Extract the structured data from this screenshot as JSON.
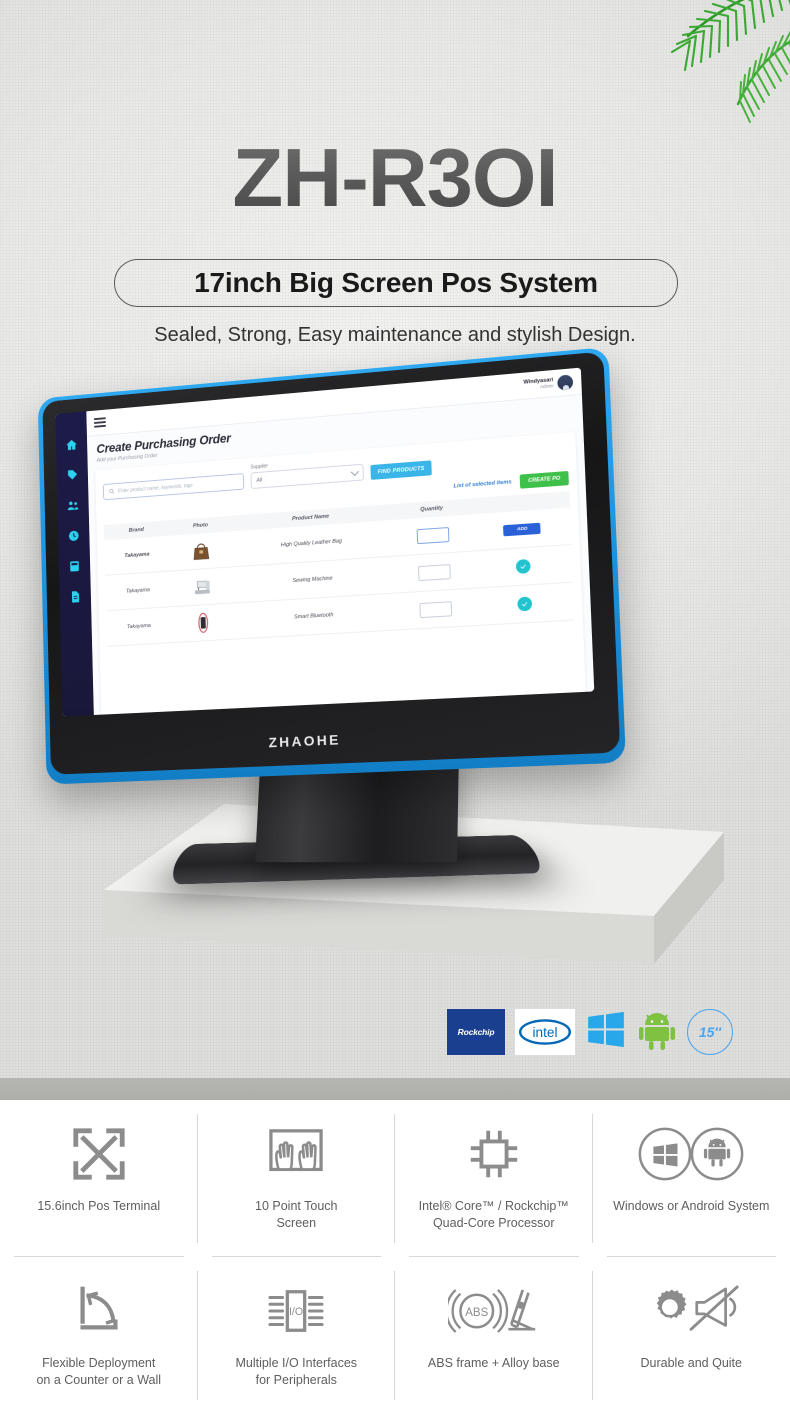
{
  "hero": {
    "title": "ZH-R3OI",
    "subtitle": "17inch Big Screen Pos System",
    "tagline": "Sealed, Strong, Easy maintenance and stylish Design."
  },
  "product": {
    "bezel_brand": "ZHAOHE",
    "accent_color": "#1e9fe8"
  },
  "pos_screen": {
    "user": {
      "name": "Windyasari",
      "role": "Admin"
    },
    "page_title": "Create Purchasing Order",
    "page_subtitle": "Add your Purchasing Order",
    "search_placeholder": "Enter product name, keywords, tags",
    "supplier_label": "Supplier",
    "supplier_value": "All",
    "find_button": "FIND PRODUCTS",
    "selected_link": "List of selected items",
    "create_po_button": "CREATE PO",
    "columns": [
      "Brand",
      "Photo",
      "Product Name",
      "Quantity",
      ""
    ],
    "rows": [
      {
        "brand": "Takayama",
        "product": "High Quality Leather Bag",
        "quantity": "",
        "action": "ADD",
        "highlight": true
      },
      {
        "brand": "Takayama",
        "product": "Sewing Machine",
        "quantity": "",
        "action": "check",
        "highlight": false
      },
      {
        "brand": "Takayama",
        "product": "Smart Bluetooth",
        "quantity": "",
        "action": "check",
        "highlight": false
      }
    ],
    "sidebar_icons": [
      "home-icon",
      "tag-icon",
      "users-icon",
      "clock-icon",
      "calculator-icon",
      "document-icon"
    ]
  },
  "badges": [
    {
      "name": "rockchip-badge",
      "label": "Rockchip"
    },
    {
      "name": "intel-badge",
      "label": "intel"
    },
    {
      "name": "windows-badge",
      "label": ""
    },
    {
      "name": "android-badge",
      "label": ""
    },
    {
      "name": "size-badge",
      "label": "15″"
    }
  ],
  "features": [
    {
      "icon": "expand-arrows-icon",
      "label": "15.6inch Pos Terminal"
    },
    {
      "icon": "touch-hands-icon",
      "label": "10 Point Touch\nScreen"
    },
    {
      "icon": "cpu-chip-icon",
      "label": "Intel® Core™ / Rockchip™\nQuad-Core Processor"
    },
    {
      "icon": "windows-android-icon",
      "label": "Windows or Android System"
    },
    {
      "icon": "wall-mount-icon",
      "label": "Flexible Deployment\non a Counter or a Wall"
    },
    {
      "icon": "io-ports-icon",
      "label": "Multiple I/O Interfaces\nfor Peripherals"
    },
    {
      "icon": "abs-frame-icon",
      "label": "ABS frame + Alloy base"
    },
    {
      "icon": "gear-mute-icon",
      "label": "Durable and Quite"
    }
  ]
}
